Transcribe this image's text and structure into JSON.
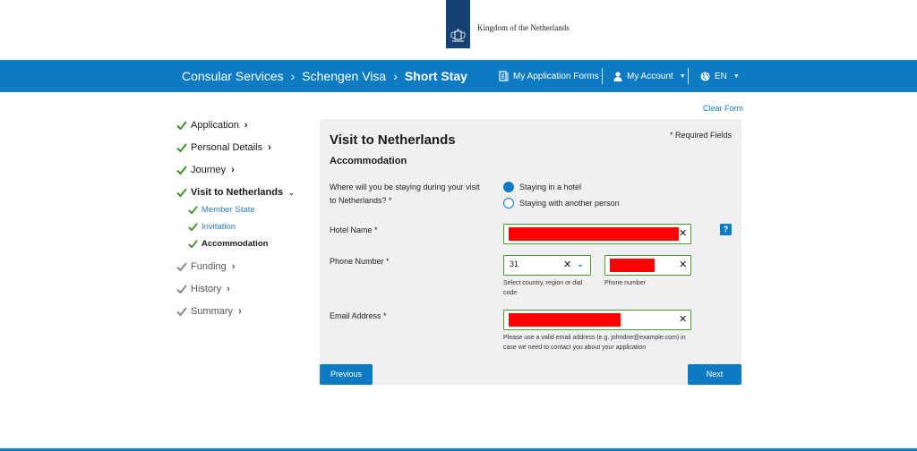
{
  "header": {
    "logo_text": "Kingdom of the Netherlands",
    "brand_color": "#154273"
  },
  "nav": {
    "accent": "#0d7bc1",
    "breadcrumbs": [
      "Consular Services",
      "Schengen Visa",
      "Short Stay"
    ],
    "my_forms": "My Application Forms",
    "my_account": "My Account",
    "language": "EN"
  },
  "sidebar": {
    "steps": [
      {
        "label": "Application",
        "state": "done"
      },
      {
        "label": "Personal Details",
        "state": "done"
      },
      {
        "label": "Journey",
        "state": "done"
      },
      {
        "label": "Visit to Netherlands",
        "state": "active"
      },
      {
        "label": "Funding",
        "state": "pending"
      },
      {
        "label": "History",
        "state": "pending"
      },
      {
        "label": "Summary",
        "state": "pending"
      }
    ],
    "substeps": [
      {
        "label": "Member State",
        "state": "done"
      },
      {
        "label": "Invitation",
        "state": "done"
      },
      {
        "label": "Accommodation",
        "state": "current"
      }
    ]
  },
  "form": {
    "clear_form": "Clear Form",
    "title": "Visit to Netherlands",
    "required_note": "* Required Fields",
    "section": "Accommodation",
    "stay_question_line1": "Where will you be staying during your visit",
    "stay_question_line2": "to Netherlands? *",
    "stay_options": [
      "Staying in a hotel",
      "Staying with another person"
    ],
    "stay_selected_index": 0,
    "hotel_label": "Hotel Name *",
    "phone_label": "Phone Number *",
    "phone_code_value": "31",
    "phone_code_hint_line1": "Select country, region or dial",
    "phone_code_hint_line2": "code",
    "phone_number_hint": "Phone number",
    "email_label": "Email Address *",
    "email_hint_line1": "Please use a valid email address (e.g. johndoe@example.com) in",
    "email_hint_line2": "case we need to contact you about your application",
    "help_label": "?",
    "previous_button": "Previous",
    "next_button": "Next",
    "valid_color": "#4a9a2e",
    "redaction_color": "#ff0000"
  }
}
